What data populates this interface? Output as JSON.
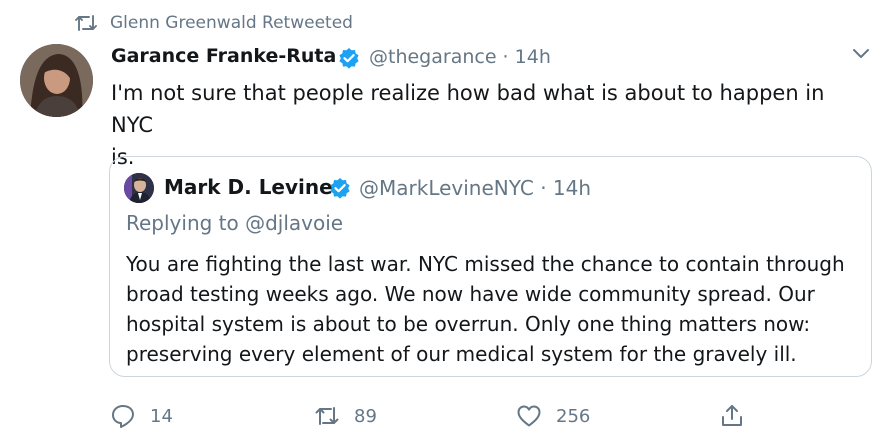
{
  "retweet_header": {
    "label": "Glenn Greenwald Retweeted"
  },
  "tweet": {
    "author_name": "Garance Franke-Ruta",
    "handle_time": "@thegarance · 14h",
    "text_line1": "I'm not sure that people realize how bad what is about to happen in NYC",
    "text_line2": "is."
  },
  "quote": {
    "author_name": "Mark D. Levine",
    "handle_time": "@MarkLevineNYC · 14h",
    "replying_to": "Replying to @djlavoie",
    "text_lines": [
      "You are fighting the last war. NYC missed the chance to contain through",
      "broad testing weeks ago. We now have wide community spread. Our",
      "hospital system is about to be overrun. Only one thing matters now:",
      "preserving every element of our medical system for the gravely ill."
    ]
  },
  "actions": {
    "replies": "14",
    "retweets": "89",
    "likes": "256"
  },
  "colors": {
    "verified": "#1da1f2",
    "muted": "#657786",
    "border": "#ccd6dd",
    "text": "#14171a"
  },
  "icons": [
    "retweet-icon",
    "chevron-down-icon",
    "verified-badge-icon",
    "reply-icon",
    "like-icon",
    "share-icon"
  ]
}
